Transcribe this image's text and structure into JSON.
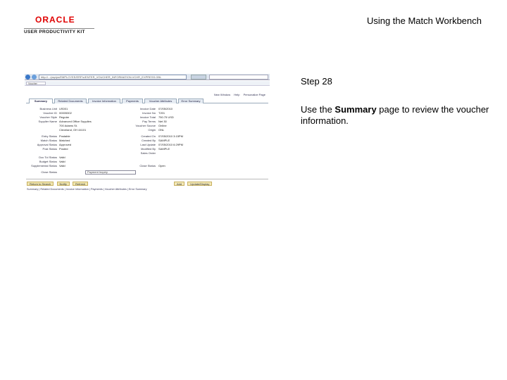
{
  "header": {
    "logo_oracle": "ORACLE",
    "logo_upk": "USER PRODUCTIVITY KIT",
    "doc_title": "Using the Match Workbench"
  },
  "screenshot": {
    "url": "http://.../psp/ps/EMPLOYEE/ERP/c/ENTER_VOUCHER_INFORMATION.VCHR_EXPRESS.GBL",
    "browser_tab": "Voucher",
    "top_links": [
      "New Window",
      "Help",
      "Personalize Page"
    ],
    "tabs": [
      "Summary",
      "Related Documents",
      "Invoice Information",
      "Payments",
      "Voucher Attributes",
      "Error Summary"
    ],
    "left_fields": [
      {
        "label": "Business Unit",
        "value": "US001"
      },
      {
        "label": "Voucher ID",
        "value": "00005302"
      },
      {
        "label": "Voucher Style",
        "value": "Regular"
      },
      {
        "label": "Supplier Name",
        "value": "Advanced Office Supplies"
      },
      {
        "label": "",
        "value": "700 Adams St."
      },
      {
        "label": "",
        "value": "Cleveland, OH 44101"
      },
      {
        "label": "Entry Status",
        "value": "Postable"
      },
      {
        "label": "Match Status",
        "value": "Matched"
      },
      {
        "label": "Approval Status",
        "value": "Approved"
      },
      {
        "label": "Post Status",
        "value": "Posted"
      },
      {
        "label": "Doc Tol Status",
        "value": "Valid"
      },
      {
        "label": "Budget Status",
        "value": "Valid"
      },
      {
        "label": "Supplemental Status",
        "value": "Valid"
      },
      {
        "label": "Close Status",
        "value": ""
      }
    ],
    "right_fields": [
      {
        "label": "Invoice Date",
        "value": "07/05/2010"
      },
      {
        "label": "Invoice No",
        "value": "T201"
      },
      {
        "label": "Invoice Total",
        "value": "750.75  USD"
      },
      {
        "label": "Pay Terms",
        "value": "Net 30"
      },
      {
        "label": "Voucher Source",
        "value": "Online"
      },
      {
        "label": "Origin",
        "value": "ONL"
      },
      {
        "label": "Created On",
        "value": "07/05/2010 3:15PM"
      },
      {
        "label": "Created By",
        "value": "SAMPLE"
      },
      {
        "label": "Last Update",
        "value": "07/05/2010 6:29PM"
      },
      {
        "label": "Modified By",
        "value": "SAMPLE"
      },
      {
        "label": "Sales Order",
        "value": ""
      },
      {
        "label": "Close Status",
        "value": "Open"
      }
    ],
    "status_select": "Payment Inquiry",
    "buttons": [
      "Return to Search",
      "Notify",
      "Refresh"
    ],
    "right_buttons": [
      "Add",
      "Update/Display"
    ],
    "footer_links": "Summary | Related Documents | Invoice Information | Payments | Voucher Attributes | Error Summary"
  },
  "step": {
    "title": "Step 28",
    "desc_prefix": "Use the ",
    "desc_bold": "Summary",
    "desc_suffix": " page to review the voucher information."
  }
}
